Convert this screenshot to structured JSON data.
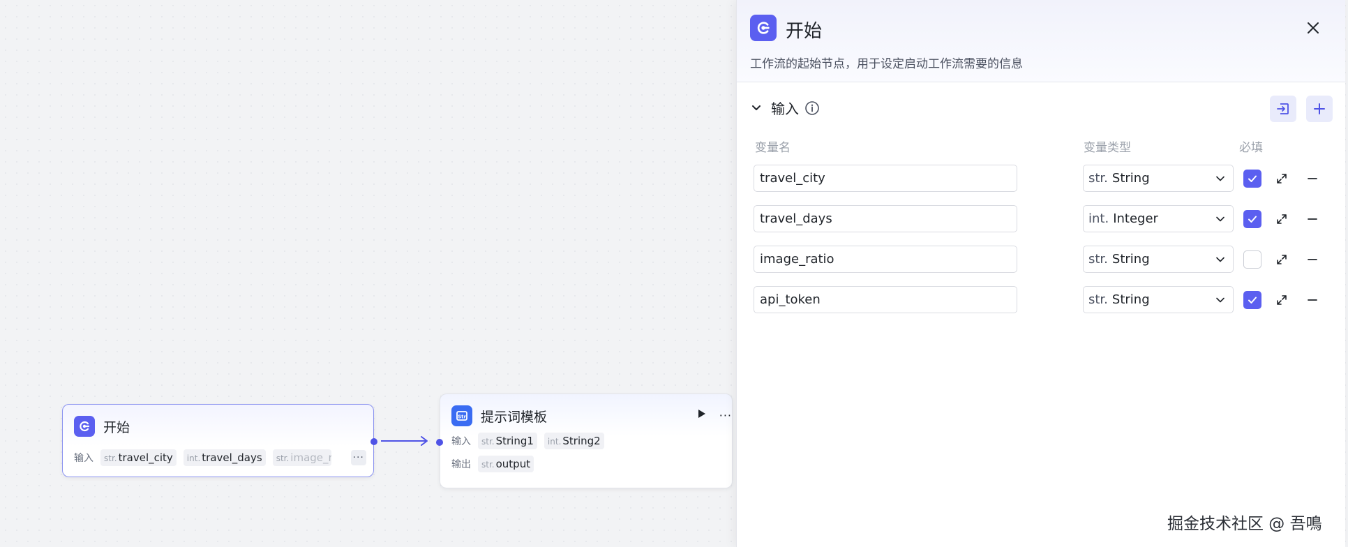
{
  "canvas": {
    "start_node": {
      "title": "开始",
      "input_label": "输入",
      "inputs": [
        {
          "type": "str.",
          "name": "travel_city"
        },
        {
          "type": "int.",
          "name": "travel_days"
        },
        {
          "type": "str.",
          "name": "image_r..."
        }
      ],
      "more_label": "···"
    },
    "prompt_node": {
      "title": "提示词模板",
      "input_label": "输入",
      "output_label": "输出",
      "inputs": [
        {
          "type": "str.",
          "name": "String1"
        },
        {
          "type": "int.",
          "name": "String2"
        }
      ],
      "outputs": [
        {
          "type": "str.",
          "name": "output"
        }
      ],
      "more_label": "···"
    }
  },
  "panel": {
    "title": "开始",
    "description": "工作流的起始节点，用于设定启动工作流需要的信息",
    "section_title": "输入",
    "columns": {
      "name": "变量名",
      "type": "变量类型",
      "required": "必填"
    },
    "variables": [
      {
        "name": "travel_city",
        "type_prefix": "str.",
        "type": "String",
        "required": true
      },
      {
        "name": "travel_days",
        "type_prefix": "int.",
        "type": "Integer",
        "required": true
      },
      {
        "name": "image_ratio",
        "type_prefix": "str.",
        "type": "String",
        "required": false
      },
      {
        "name": "api_token",
        "type_prefix": "str.",
        "type": "String",
        "required": true
      }
    ]
  },
  "watermark": "掘金技术社区 @ 吾鳴",
  "colors": {
    "accent": "#5b5ff0",
    "prompt_icon": "#3a6cf2",
    "edge": "#4f53e6"
  }
}
